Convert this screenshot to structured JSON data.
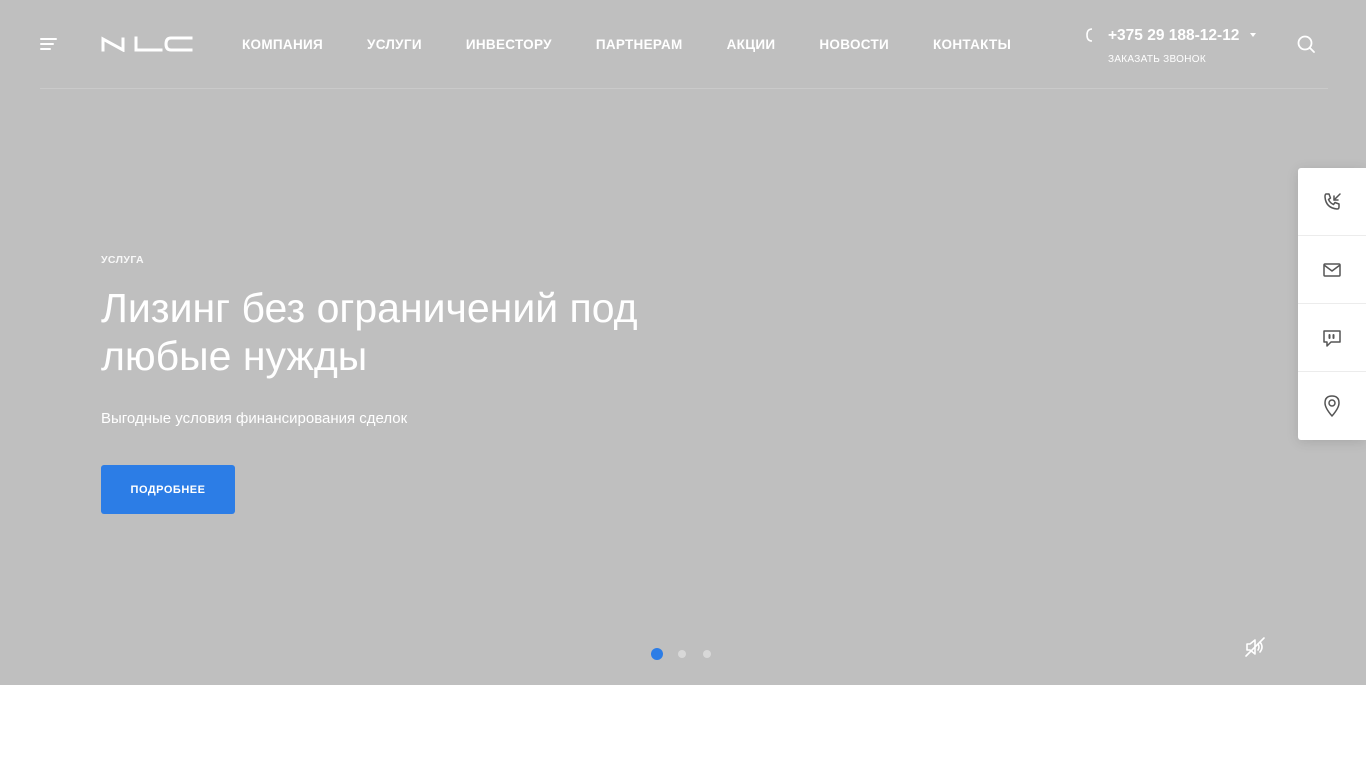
{
  "header": {
    "menu_icon": "burger-menu-icon",
    "logo_icon": "nlc-logo",
    "nav": [
      {
        "label": "КОМПАНИЯ"
      },
      {
        "label": "УСЛУГИ"
      },
      {
        "label": "ИНВЕСТОРУ"
      },
      {
        "label": "ПАРТНЕРАМ"
      },
      {
        "label": "АКЦИИ"
      },
      {
        "label": "НОВОСТИ"
      },
      {
        "label": "КОНТАКТЫ"
      }
    ],
    "phone": {
      "number": "+375 29 188-12-12",
      "callback": "ЗАКАЗАТЬ ЗВОНОК",
      "icon": "phone-icon"
    },
    "search_icon": "search-icon"
  },
  "slide": {
    "label": "УСЛУГА",
    "title_line1": "Лизинг без ограничений под",
    "title_line2": "любые нужды",
    "subtitle": "Выгодные условия финансирования сделок",
    "button_label": "ПОДРОБНЕЕ"
  },
  "slider": {
    "dot_count": 3,
    "active_index": 0,
    "mute_icon": "sound-off-icon"
  },
  "side_panel": [
    {
      "icon": "phone-incoming-icon"
    },
    {
      "icon": "mail-icon"
    },
    {
      "icon": "chat-quote-icon"
    },
    {
      "icon": "location-pin-icon"
    }
  ],
  "colors": {
    "hero_bg": "#bfbfbf",
    "accent": "#2c7de6",
    "text_on_hero": "#ffffff"
  }
}
